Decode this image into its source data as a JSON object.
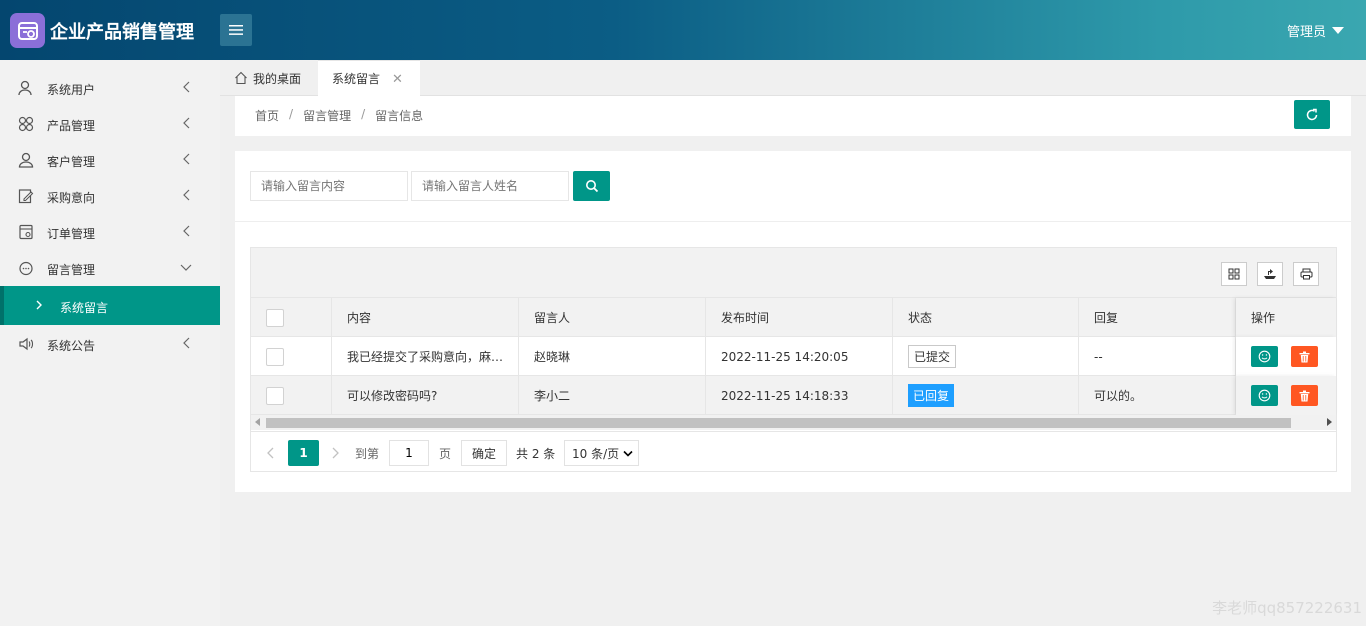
{
  "header": {
    "app_title": "企业产品销售管理",
    "user_name": "管理员"
  },
  "sidebar": {
    "items": [
      {
        "label": "系统用户",
        "icon": "user-icon"
      },
      {
        "label": "产品管理",
        "icon": "product-icon"
      },
      {
        "label": "客户管理",
        "icon": "customer-icon"
      },
      {
        "label": "采购意向",
        "icon": "edit-icon"
      },
      {
        "label": "订单管理",
        "icon": "order-icon"
      },
      {
        "label": "留言管理",
        "icon": "message-icon",
        "expanded": true
      },
      {
        "label": "系统公告",
        "icon": "speaker-icon"
      }
    ],
    "sub_item": "系统留言"
  },
  "tabs": {
    "home": "我的桌面",
    "active": "系统留言"
  },
  "breadcrumb": [
    "首页",
    "留言管理",
    "留言信息"
  ],
  "search": {
    "content_placeholder": "请输入留言内容",
    "name_placeholder": "请输入留言人姓名"
  },
  "table": {
    "columns": [
      "内容",
      "留言人",
      "发布时间",
      "状态",
      "回复",
      "操作"
    ],
    "rows": [
      {
        "content": "我已经提交了采购意向，麻烦尽快处理",
        "author": "赵晓琳",
        "time": "2022-11-25 14:20:05",
        "status": "已提交",
        "reply": "--"
      },
      {
        "content": "可以修改密码吗?",
        "author": "李小二",
        "time": "2022-11-25 14:18:33",
        "status": "已回复",
        "reply": "可以的。"
      }
    ]
  },
  "pager": {
    "current_page": "1",
    "goto_label": "到第",
    "page_input": "1",
    "page_suffix": "页",
    "confirm_label": "确定",
    "total_label": "共 2 条",
    "page_size": "10 条/页"
  },
  "colors": {
    "accent": "#009688",
    "danger": "#ff5722",
    "info": "#1e9fff",
    "logo": "#8b6fd8"
  },
  "watermark": "李老师qq857222631"
}
